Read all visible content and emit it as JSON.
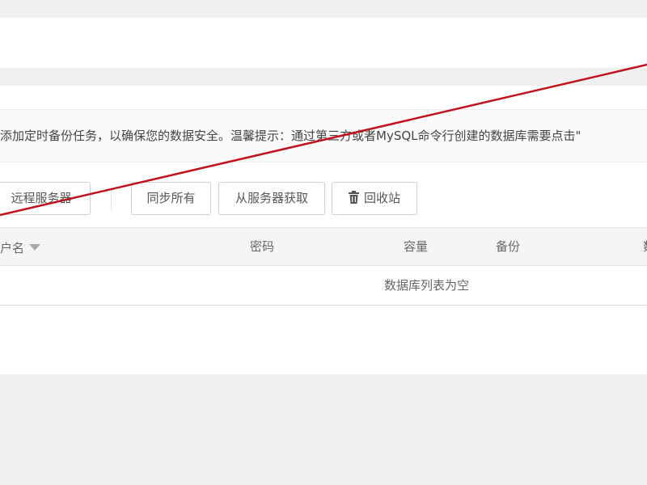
{
  "notice": {
    "text": "添加定时备份任务，以确保您的数据安全。温馨提示：通过第三方或者MySQL命令行创建的数据库需要点击\""
  },
  "toolbar": {
    "remote_server_label": "远程服务器",
    "sync_all_label": "同步所有",
    "fetch_from_server_label": "从服务器获取",
    "recycle_bin_label": "回收站",
    "recycle_bin_icon": "trash-icon"
  },
  "table": {
    "columns": [
      "户名",
      "密码",
      "容量",
      "备份",
      "数"
    ],
    "sort_icon": "sort-down-icon",
    "empty_text": "数据库列表为空"
  },
  "overlay": {
    "cross_line_color": "#c0121c"
  }
}
